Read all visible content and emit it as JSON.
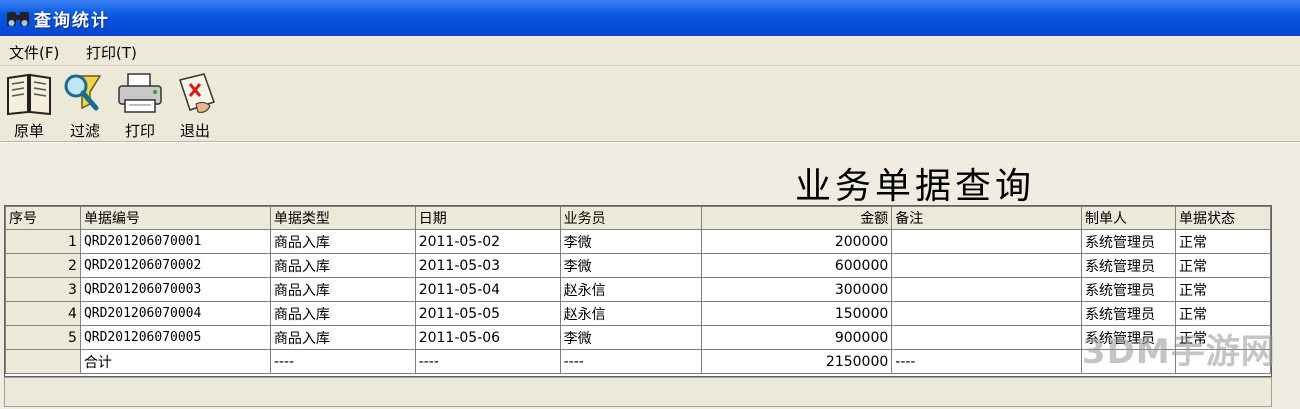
{
  "window": {
    "title": "查询统计",
    "title_bar_color": "#0a58e2"
  },
  "menu": [
    {
      "label": "文件(F)"
    },
    {
      "label": "打印(T)"
    }
  ],
  "toolbar": [
    {
      "label": "原单",
      "icon": "book-icon"
    },
    {
      "label": "过滤",
      "icon": "filter-magnifier-icon"
    },
    {
      "label": "打印",
      "icon": "printer-icon"
    },
    {
      "label": "退出",
      "icon": "exit-icon"
    }
  ],
  "report": {
    "title": "业务单据查询"
  },
  "table": {
    "columns": [
      "序号",
      "单据编号",
      "单据类型",
      "日期",
      "业务员",
      "金额",
      "备注",
      "制单人",
      "单据状态"
    ],
    "rows": [
      [
        "1",
        "QRD201206070001",
        "商品入库",
        "2011-05-02",
        "李微",
        "200000",
        "",
        "系统管理员",
        "正常"
      ],
      [
        "2",
        "QRD201206070002",
        "商品入库",
        "2011-05-03",
        "李微",
        "600000",
        "",
        "系统管理员",
        "正常"
      ],
      [
        "3",
        "QRD201206070003",
        "商品入库",
        "2011-05-04",
        "赵永信",
        "300000",
        "",
        "系统管理员",
        "正常"
      ],
      [
        "4",
        "QRD201206070004",
        "商品入库",
        "2011-05-05",
        "赵永信",
        "150000",
        "",
        "系统管理员",
        "正常"
      ],
      [
        "5",
        "QRD201206070005",
        "商品入库",
        "2011-05-06",
        "李微",
        "900000",
        "",
        "系统管理员",
        "正常"
      ]
    ],
    "total_row": [
      "",
      "合计",
      "----",
      "----",
      "----",
      "2150000",
      "----",
      "",
      ""
    ]
  },
  "watermark": {
    "text": "3DM手游网"
  },
  "colors": {
    "window_bg": "#ece9d8",
    "grid_line": "#808080",
    "title_bar": "#0a58e2"
  }
}
